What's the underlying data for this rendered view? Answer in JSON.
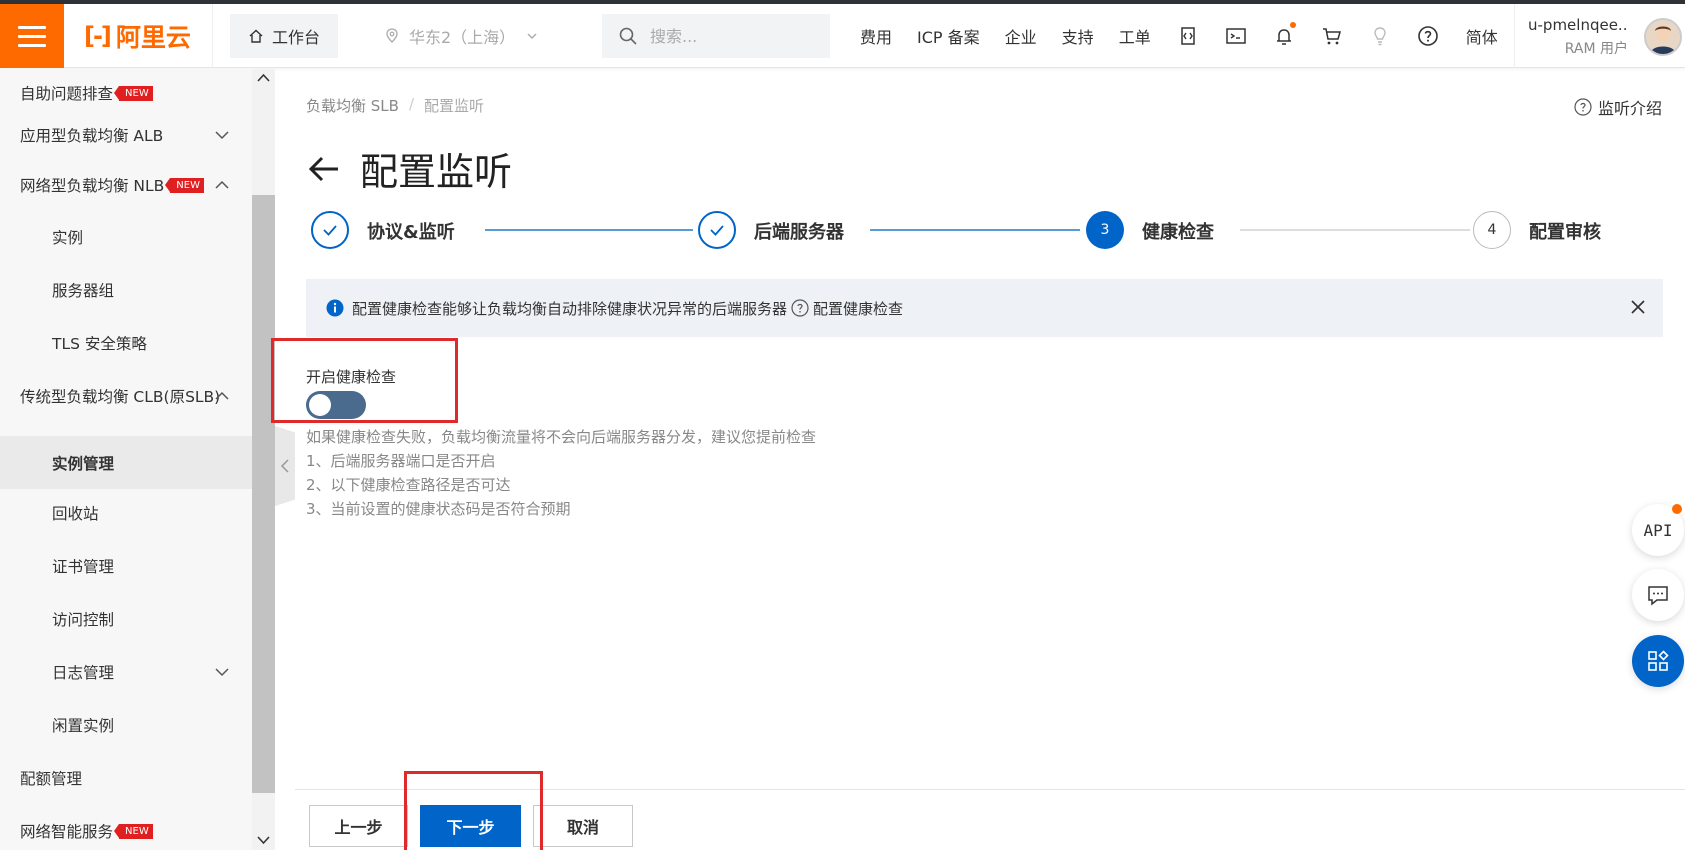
{
  "topbar": {
    "brand_name": "阿里云",
    "workbench_label": "工作台",
    "region_label": "华东2（上海）",
    "search_placeholder": "搜索...",
    "links": {
      "fees": "费用",
      "icp": "ICP 备案",
      "enterprise": "企业",
      "support": "支持",
      "ticket": "工单"
    },
    "language": "简体",
    "user_name": "u-pmelnqee...",
    "user_role": "RAM 用户",
    "accent_color": "#ff6a00"
  },
  "sidebar": {
    "new_badge": "NEW",
    "items": {
      "self_check": "自助问题排查",
      "alb": "应用型负载均衡 ALB",
      "nlb": "网络型负载均衡 NLB",
      "nlb_instance": "实例",
      "nlb_server_group": "服务器组",
      "nlb_tls": "TLS 安全策略",
      "clb": "传统型负载均衡 CLB(原SLB)",
      "clb_instance_mgmt": "实例管理",
      "clb_recycle": "回收站",
      "clb_cert": "证书管理",
      "clb_acl": "访问控制",
      "clb_log": "日志管理",
      "clb_idle": "闲置实例",
      "quota": "配额管理",
      "smart_service": "网络智能服务"
    }
  },
  "breadcrumb": {
    "root": "负载均衡 SLB",
    "separator": "/",
    "current": "配置监听"
  },
  "help_link": "监听介绍",
  "page_title": "配置监听",
  "steps": [
    {
      "label": "协议&监听",
      "state": "done"
    },
    {
      "label": "后端服务器",
      "state": "done"
    },
    {
      "number": "3",
      "label": "健康检查",
      "state": "current"
    },
    {
      "number": "4",
      "label": "配置审核",
      "state": "pending"
    }
  ],
  "alert": {
    "text": "配置健康检查能够让负载均衡自动排除健康状况异常的后端服务器",
    "link": "配置健康检查"
  },
  "health_check": {
    "switch_label": "开启健康检查",
    "enabled": false,
    "hint_lines": [
      "如果健康检查失败，负载均衡流量将不会向后端服务器分发，建议您提前检查",
      "1、后端服务器端口是否开启",
      "2、以下健康检查路径是否可达",
      "3、当前设置的健康状态码是否符合预期"
    ]
  },
  "footer": {
    "prev_label": "上一步",
    "next_label": "下一步",
    "cancel_label": "取消"
  },
  "float_buttons": {
    "api_label": "API"
  },
  "colors": {
    "primary": "#0064c8",
    "highlight": "#e02a2a",
    "badge": "#e02020"
  }
}
